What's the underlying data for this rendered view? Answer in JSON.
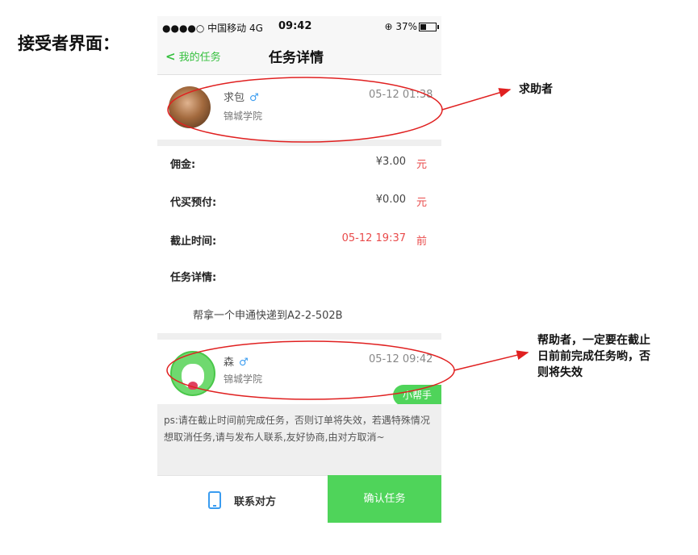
{
  "page_label": "接受者界面：",
  "status_bar": {
    "carrier": "●●●●○ 中国移动 4G",
    "time": "09:42",
    "battery": "⊕ 37%"
  },
  "nav": {
    "back_label": "我的任务",
    "title": "任务详情"
  },
  "requester": {
    "name": "求包",
    "gender_symbol": "♂",
    "school": "锦城学院",
    "date": "05-12 01:38"
  },
  "details": {
    "commission_label": "佣金:",
    "commission_value": "¥3.00",
    "commission_unit": "元",
    "prepay_label": "代买预付:",
    "prepay_value": "¥0.00",
    "prepay_unit": "元",
    "deadline_label": "截止时间:",
    "deadline_value": "05-12 19:37",
    "deadline_unit": "前",
    "task_label": "任务详情:",
    "task_desc": "帮拿一个申通快递到A2-2-502B"
  },
  "helper": {
    "name": "森",
    "gender_symbol": "♂",
    "school": "锦城学院",
    "date": "05-12 09:42",
    "tag": "小帮手"
  },
  "notice": "ps:请在截止时间前完成任务，否则订单将失效，若遇特殊情况想取消任务,请与发布人联系,友好协商,由对方取消~",
  "actions": {
    "contact_label": "联系对方",
    "confirm_label": "确认任务"
  },
  "annotations": {
    "requester_note": "求助者",
    "helper_note_line1": "帮助者，一定要在截止",
    "helper_note_line2": "日前前完成任务哟，否",
    "helper_note_line3": "则将失效"
  },
  "colors": {
    "accent_green": "#4fd45a",
    "annotation_red": "#e02020",
    "warning_red": "#e94b4b",
    "gender_blue": "#3a9cf0"
  }
}
